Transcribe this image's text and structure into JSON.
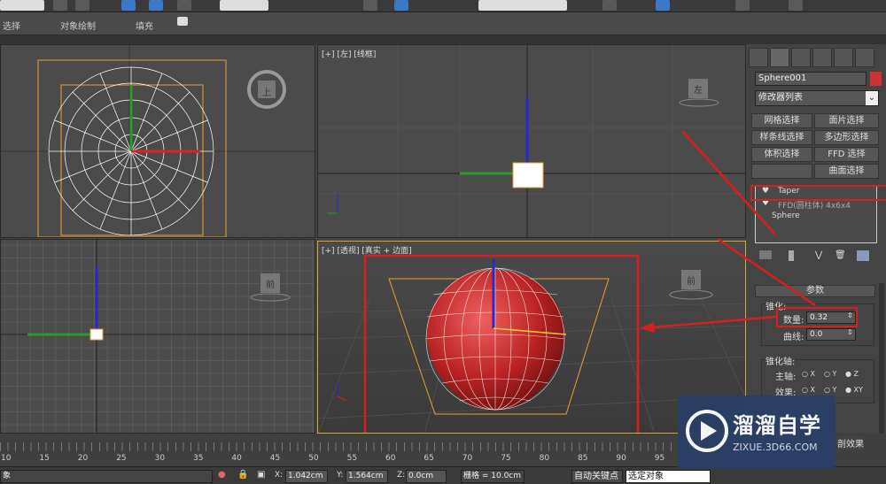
{
  "ribbon": {
    "items": [
      "选择",
      "对象绘制",
      "填充"
    ]
  },
  "viewports": {
    "top_left": {
      "cube_label": "上"
    },
    "top_right": {
      "label_plus": "[+]",
      "label_view": "[左]",
      "label_mode": "[线框]",
      "cube_label": "左"
    },
    "bottom_left": {
      "cube_label": "前"
    },
    "bottom_right": {
      "label_plus": "[+]",
      "label_view": "[透视]",
      "label_mode": "[真实 + 边面]",
      "cube_label": "前"
    }
  },
  "axes": {
    "x": "x",
    "y": "y",
    "z": "z"
  },
  "panel": {
    "object_name": "Sphere001",
    "object_color": "#cc3333",
    "modifier_list": "修改器列表",
    "buttons": [
      "网格选择",
      "面片选择",
      "样条线选择",
      "多边形选择",
      "体积选择",
      "FFD 选择",
      "",
      "曲面选择"
    ],
    "stack": [
      "Taper",
      "FFD(圆柱体) 4x6x4",
      "Sphere"
    ],
    "rollout_title": "参数",
    "taper_group": "锥化:",
    "amount_label": "数量:",
    "amount_value": "0.32",
    "curve_label": "曲线:",
    "curve_value": "0.0",
    "axis_group": "锥化轴:",
    "primary_label": "主轴:",
    "primary_options": [
      "X",
      "Y",
      "Z"
    ],
    "primary_selected": "Z",
    "effect_label": "效果:",
    "effect_options": [
      "X",
      "Y",
      "XY"
    ],
    "effect_selected": "XY",
    "partial": "剖效果"
  },
  "timeline": {
    "ticks": [
      "10",
      "15",
      "20",
      "25",
      "30",
      "35",
      "40",
      "45",
      "50",
      "55",
      "60",
      "65",
      "70",
      "75",
      "80",
      "85",
      "90",
      "95"
    ]
  },
  "status": {
    "left_text": "象",
    "x_label": "X:",
    "x_value": "1.042cm",
    "y_label": "Y:",
    "y_value": "1.564cm",
    "z_label": "Z:",
    "z_value": "0.0cm",
    "grid": "栅格 = 10.0cm",
    "autokey": "自动关键点",
    "selection": "选定对象"
  },
  "watermark": {
    "title": "溜溜自学",
    "url": "ZIXUE.3D66.COM"
  },
  "colors": {
    "highlight": "#d42020",
    "accent": "#3c78c8"
  }
}
